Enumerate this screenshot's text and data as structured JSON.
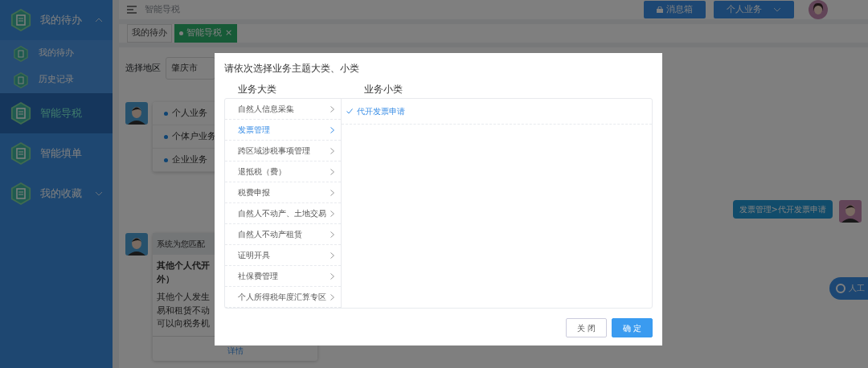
{
  "sidebar": {
    "items": [
      {
        "label": "我的待办",
        "selected": false,
        "expanded": true,
        "children": [
          {
            "label": "我的待办",
            "selected": false
          },
          {
            "label": "历史记录",
            "selected": false
          }
        ]
      },
      {
        "label": "智能导税",
        "selected": true
      },
      {
        "label": "智能填单",
        "selected": false
      },
      {
        "label": "我的收藏",
        "selected": false,
        "expanded": false
      }
    ]
  },
  "topbar": {
    "title": "智能导税",
    "buttons": [
      {
        "kind": "message",
        "label": "消息箱"
      },
      {
        "kind": "dropdown",
        "label": "个人业务"
      }
    ]
  },
  "tabs": [
    {
      "label": "我的待办",
      "selected": false
    },
    {
      "label": "智能导税",
      "selected": true,
      "close": "×"
    }
  ],
  "region": {
    "label": "选择地区",
    "value": "肇庆市"
  },
  "business_card": {
    "items": [
      "个人业务",
      "个体户业务",
      "企业业务"
    ]
  },
  "match_card": {
    "header": "系统为您匹配",
    "title": [
      "其他个人代开",
      "外）"
    ],
    "description": [
      "其他个人发生",
      "易和租赁不动",
      "可以向税务机"
    ],
    "link": "详情"
  },
  "user_message": "发票管理>代开发票申请",
  "help_button": "人工",
  "modal": {
    "title": "请依次选择业务主题大类、小类",
    "major_header": "业务大类",
    "minor_header": "业务小类",
    "major": [
      {
        "label": "自然人信息采集",
        "selected": false
      },
      {
        "label": "发票管理",
        "selected": true
      },
      {
        "label": "跨区域涉税事项管理",
        "selected": false
      },
      {
        "label": "退抵税（费）",
        "selected": false
      },
      {
        "label": "税费申报",
        "selected": false
      },
      {
        "label": "自然人不动产、土地交易",
        "selected": false
      },
      {
        "label": "自然人不动产租赁",
        "selected": false
      },
      {
        "label": "证明开具",
        "selected": false
      },
      {
        "label": "社保费管理",
        "selected": false
      },
      {
        "label": "个人所得税年度汇算专区",
        "selected": false
      }
    ],
    "minor": [
      {
        "label": "代开发票申请",
        "selected": true
      }
    ],
    "buttons": [
      {
        "kind": "close",
        "label": "关 闭"
      },
      {
        "kind": "confirm",
        "label": "确 定"
      }
    ]
  }
}
